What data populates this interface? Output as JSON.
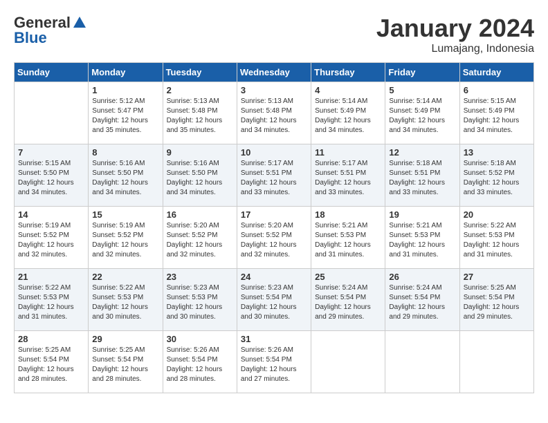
{
  "logo": {
    "general": "General",
    "blue": "Blue"
  },
  "title": {
    "month": "January 2024",
    "location": "Lumajang, Indonesia"
  },
  "headers": [
    "Sunday",
    "Monday",
    "Tuesday",
    "Wednesday",
    "Thursday",
    "Friday",
    "Saturday"
  ],
  "weeks": [
    [
      {
        "day": "",
        "info": ""
      },
      {
        "day": "1",
        "info": "Sunrise: 5:12 AM\nSunset: 5:47 PM\nDaylight: 12 hours\nand 35 minutes."
      },
      {
        "day": "2",
        "info": "Sunrise: 5:13 AM\nSunset: 5:48 PM\nDaylight: 12 hours\nand 35 minutes."
      },
      {
        "day": "3",
        "info": "Sunrise: 5:13 AM\nSunset: 5:48 PM\nDaylight: 12 hours\nand 34 minutes."
      },
      {
        "day": "4",
        "info": "Sunrise: 5:14 AM\nSunset: 5:49 PM\nDaylight: 12 hours\nand 34 minutes."
      },
      {
        "day": "5",
        "info": "Sunrise: 5:14 AM\nSunset: 5:49 PM\nDaylight: 12 hours\nand 34 minutes."
      },
      {
        "day": "6",
        "info": "Sunrise: 5:15 AM\nSunset: 5:49 PM\nDaylight: 12 hours\nand 34 minutes."
      }
    ],
    [
      {
        "day": "7",
        "info": "Sunrise: 5:15 AM\nSunset: 5:50 PM\nDaylight: 12 hours\nand 34 minutes."
      },
      {
        "day": "8",
        "info": "Sunrise: 5:16 AM\nSunset: 5:50 PM\nDaylight: 12 hours\nand 34 minutes."
      },
      {
        "day": "9",
        "info": "Sunrise: 5:16 AM\nSunset: 5:50 PM\nDaylight: 12 hours\nand 34 minutes."
      },
      {
        "day": "10",
        "info": "Sunrise: 5:17 AM\nSunset: 5:51 PM\nDaylight: 12 hours\nand 33 minutes."
      },
      {
        "day": "11",
        "info": "Sunrise: 5:17 AM\nSunset: 5:51 PM\nDaylight: 12 hours\nand 33 minutes."
      },
      {
        "day": "12",
        "info": "Sunrise: 5:18 AM\nSunset: 5:51 PM\nDaylight: 12 hours\nand 33 minutes."
      },
      {
        "day": "13",
        "info": "Sunrise: 5:18 AM\nSunset: 5:52 PM\nDaylight: 12 hours\nand 33 minutes."
      }
    ],
    [
      {
        "day": "14",
        "info": "Sunrise: 5:19 AM\nSunset: 5:52 PM\nDaylight: 12 hours\nand 32 minutes."
      },
      {
        "day": "15",
        "info": "Sunrise: 5:19 AM\nSunset: 5:52 PM\nDaylight: 12 hours\nand 32 minutes."
      },
      {
        "day": "16",
        "info": "Sunrise: 5:20 AM\nSunset: 5:52 PM\nDaylight: 12 hours\nand 32 minutes."
      },
      {
        "day": "17",
        "info": "Sunrise: 5:20 AM\nSunset: 5:52 PM\nDaylight: 12 hours\nand 32 minutes."
      },
      {
        "day": "18",
        "info": "Sunrise: 5:21 AM\nSunset: 5:53 PM\nDaylight: 12 hours\nand 31 minutes."
      },
      {
        "day": "19",
        "info": "Sunrise: 5:21 AM\nSunset: 5:53 PM\nDaylight: 12 hours\nand 31 minutes."
      },
      {
        "day": "20",
        "info": "Sunrise: 5:22 AM\nSunset: 5:53 PM\nDaylight: 12 hours\nand 31 minutes."
      }
    ],
    [
      {
        "day": "21",
        "info": "Sunrise: 5:22 AM\nSunset: 5:53 PM\nDaylight: 12 hours\nand 31 minutes."
      },
      {
        "day": "22",
        "info": "Sunrise: 5:22 AM\nSunset: 5:53 PM\nDaylight: 12 hours\nand 30 minutes."
      },
      {
        "day": "23",
        "info": "Sunrise: 5:23 AM\nSunset: 5:53 PM\nDaylight: 12 hours\nand 30 minutes."
      },
      {
        "day": "24",
        "info": "Sunrise: 5:23 AM\nSunset: 5:54 PM\nDaylight: 12 hours\nand 30 minutes."
      },
      {
        "day": "25",
        "info": "Sunrise: 5:24 AM\nSunset: 5:54 PM\nDaylight: 12 hours\nand 29 minutes."
      },
      {
        "day": "26",
        "info": "Sunrise: 5:24 AM\nSunset: 5:54 PM\nDaylight: 12 hours\nand 29 minutes."
      },
      {
        "day": "27",
        "info": "Sunrise: 5:25 AM\nSunset: 5:54 PM\nDaylight: 12 hours\nand 29 minutes."
      }
    ],
    [
      {
        "day": "28",
        "info": "Sunrise: 5:25 AM\nSunset: 5:54 PM\nDaylight: 12 hours\nand 28 minutes."
      },
      {
        "day": "29",
        "info": "Sunrise: 5:25 AM\nSunset: 5:54 PM\nDaylight: 12 hours\nand 28 minutes."
      },
      {
        "day": "30",
        "info": "Sunrise: 5:26 AM\nSunset: 5:54 PM\nDaylight: 12 hours\nand 28 minutes."
      },
      {
        "day": "31",
        "info": "Sunrise: 5:26 AM\nSunset: 5:54 PM\nDaylight: 12 hours\nand 27 minutes."
      },
      {
        "day": "",
        "info": ""
      },
      {
        "day": "",
        "info": ""
      },
      {
        "day": "",
        "info": ""
      }
    ]
  ]
}
